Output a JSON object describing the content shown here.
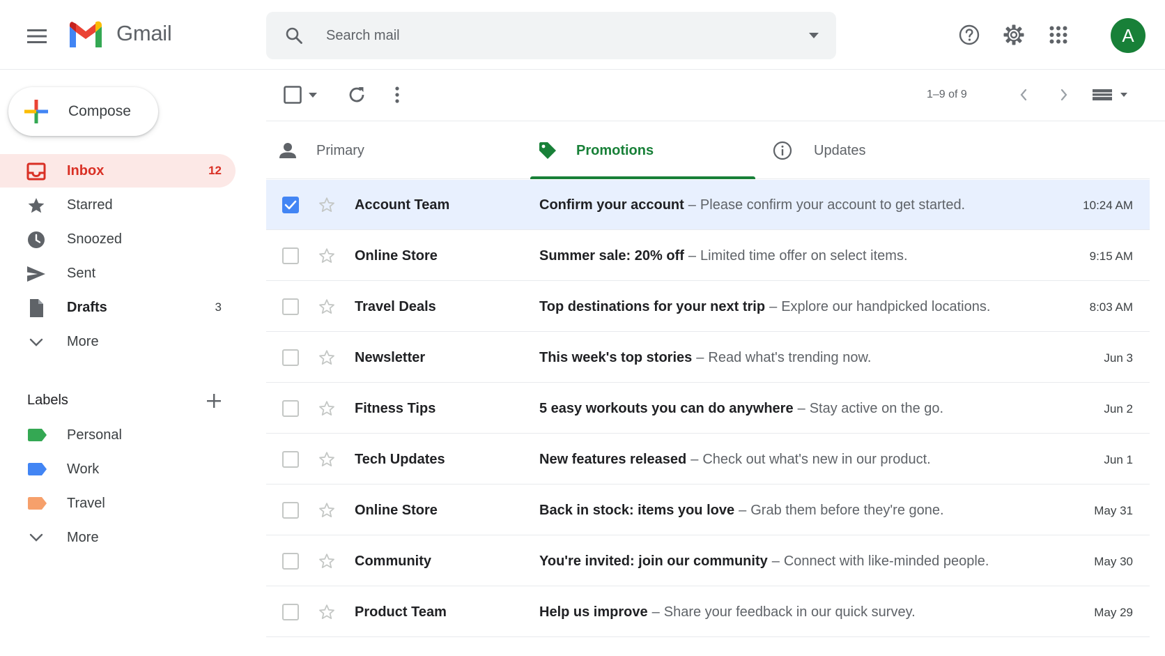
{
  "app": {
    "name": "Gmail"
  },
  "colors": {
    "gmail_red": "#ea4335",
    "gmail_blue": "#4285f4",
    "gmail_green": "#34a853",
    "gmail_yellow": "#fbbc04",
    "promotions_green": "#188038",
    "avatar_bg": "#188038",
    "selected_row": "#e8f0fe",
    "active_nav_bg": "#fce8e6"
  },
  "header": {
    "menu_icon": "hamburger-menu-icon",
    "search": {
      "placeholder": "Search mail",
      "value": ""
    },
    "avatar_initial": "A",
    "icons": [
      "help-icon",
      "settings-icon",
      "apps-grid-icon"
    ]
  },
  "sidebar": {
    "compose_label": "Compose",
    "nav": [
      {
        "label": "Inbox",
        "count": "12",
        "icon": "inbox-icon",
        "active": true
      },
      {
        "label": "Starred",
        "count": "",
        "icon": "star-icon"
      },
      {
        "label": "Snoozed",
        "count": "",
        "icon": "clock-icon"
      },
      {
        "label": "Sent",
        "count": "",
        "icon": "send-icon"
      },
      {
        "label": "Drafts",
        "count": "3",
        "icon": "draft-icon"
      },
      {
        "label": "More",
        "count": "",
        "icon": "chevron-down-icon"
      }
    ],
    "labels_title": "Labels",
    "labels": [
      {
        "label": "Personal",
        "color": "#34a853"
      },
      {
        "label": "Work",
        "color": "#4285f4"
      },
      {
        "label": "Travel",
        "color": "#f6a06b"
      }
    ],
    "labels_more": "More"
  },
  "toolbar": {
    "pager": "1–9 of 9"
  },
  "tabs": [
    {
      "label": "Primary",
      "icon": "person-icon",
      "active": false
    },
    {
      "label": "Promotions",
      "icon": "tag-icon",
      "active": true
    },
    {
      "label": "Updates",
      "icon": "info-icon",
      "active": false
    }
  ],
  "emails": [
    {
      "sender": "Account Team",
      "subject": "Confirm your account",
      "snippet": "Please confirm your account to get started.",
      "date": "10:24 AM",
      "selected": true
    },
    {
      "sender": "Online Store",
      "subject": "Summer sale: 20% off",
      "snippet": "Limited time offer on select items.",
      "date": "9:15 AM",
      "selected": false
    },
    {
      "sender": "Travel Deals",
      "subject": "Top destinations for your next trip",
      "snippet": "Explore our handpicked locations.",
      "date": "8:03 AM",
      "selected": false
    },
    {
      "sender": "Newsletter",
      "subject": "This week's top stories",
      "snippet": "Read what's trending now.",
      "date": "Jun 3",
      "selected": false
    },
    {
      "sender": "Fitness Tips",
      "subject": "5 easy workouts you can do anywhere",
      "snippet": "Stay active on the go.",
      "date": "Jun 2",
      "selected": false
    },
    {
      "sender": "Tech Updates",
      "subject": "New features released",
      "snippet": "Check out what's new in our product.",
      "date": "Jun 1",
      "selected": false
    },
    {
      "sender": "Online Store",
      "subject": "Back in stock: items you love",
      "snippet": "Grab them before they're gone.",
      "date": "May 31",
      "selected": false
    },
    {
      "sender": "Community",
      "subject": "You're invited: join our community",
      "snippet": "Connect with like-minded people.",
      "date": "May 30",
      "selected": false
    },
    {
      "sender": "Product Team",
      "subject": "Help us improve",
      "snippet": "Share your feedback in our quick survey.",
      "date": "May 29",
      "selected": false
    }
  ]
}
